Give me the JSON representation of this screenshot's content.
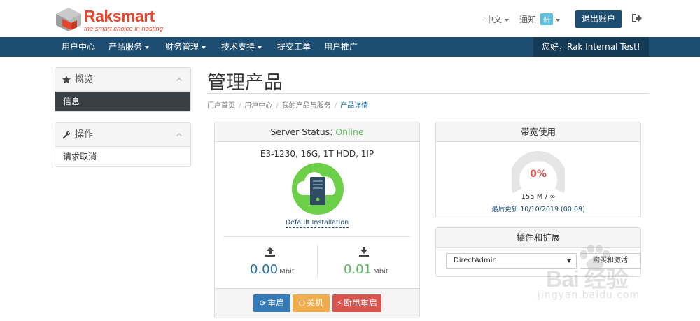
{
  "brand": {
    "name": "Raksmart",
    "tagline": "the smart choice in hosting"
  },
  "header": {
    "language": "中文",
    "notice_label": "通知",
    "notice_badge": "新",
    "logout_label": "退出账户"
  },
  "nav": {
    "items": [
      {
        "label": "用户中心",
        "dropdown": false
      },
      {
        "label": "产品服务",
        "dropdown": true
      },
      {
        "label": "财务管理",
        "dropdown": true
      },
      {
        "label": "技术支持",
        "dropdown": true
      },
      {
        "label": "提交工单",
        "dropdown": false
      },
      {
        "label": "用户推广",
        "dropdown": false
      }
    ],
    "greeting": "您好，Rak Internal Test!"
  },
  "sidebar": {
    "overview": {
      "title": "概览",
      "items": [
        {
          "label": "信息",
          "active": true
        }
      ]
    },
    "actions": {
      "title": "操作",
      "items": [
        {
          "label": "请求取消",
          "active": false
        }
      ]
    }
  },
  "page": {
    "title": "管理产品",
    "breadcrumb": [
      "门户首页",
      "用户中心",
      "我的产品与服务",
      "产品详情"
    ]
  },
  "server_panel": {
    "status_label": "Server Status:",
    "status_value": "Online",
    "spec": "E3-1230, 16G, 1T HDD, 1IP",
    "install_link": "Default Installation",
    "upload": {
      "value": "0.00",
      "unit": "Mbit"
    },
    "download": {
      "value": "0.01",
      "unit": "Mbit"
    },
    "buttons": {
      "restart": "重启",
      "shutdown": "关机",
      "power_cycle": "断电重启"
    }
  },
  "bandwidth_panel": {
    "title": "带宽使用",
    "percent": "0%",
    "percent_value": 0,
    "usage": "155 M / ∞",
    "updated_label": "最后更新",
    "updated_value": "10/10/2019 (00:09)"
  },
  "addons_panel": {
    "title": "插件和扩展",
    "select_value": "DirectAdmin",
    "activate_label": "购买和激活"
  },
  "watermark": {
    "text": "Bai 经验",
    "sub": "jingyan.baidu.com"
  },
  "colors": {
    "brand_red": "#e8462f",
    "nav_blue": "#1d4e72",
    "online_green": "#5cb85c",
    "danger_red": "#d9534f",
    "warning_orange": "#f0ad4e",
    "primary_blue": "#337ab7"
  },
  "icons": [
    "star-icon",
    "wrench-icon",
    "chevron-up-icon",
    "logout-icon",
    "upload-icon",
    "download-icon",
    "refresh-icon",
    "power-icon",
    "plug-icon",
    "server-cloud-icon"
  ]
}
